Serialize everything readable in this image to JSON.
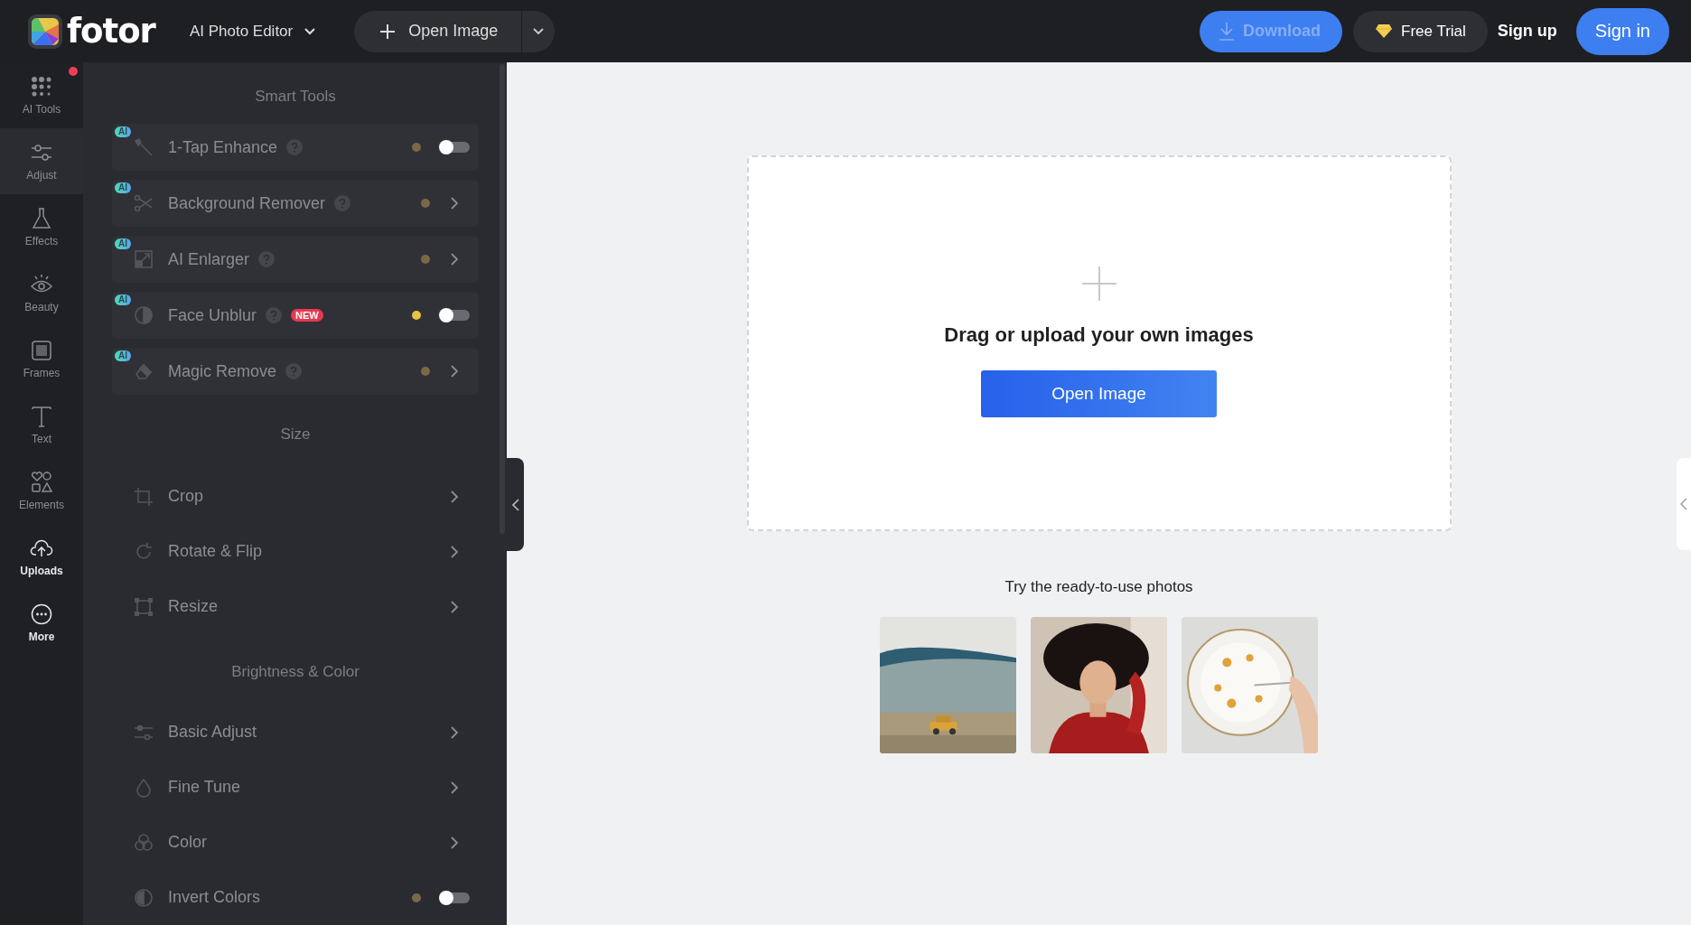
{
  "topbar": {
    "logo": "fotor",
    "editor_menu": "AI Photo Editor",
    "open_image": "Open Image",
    "download": {
      "label": "Download",
      "disabled": true
    },
    "free_trial": "Free Trial",
    "sign_up": "Sign up",
    "sign_in": "Sign in"
  },
  "rail": [
    {
      "label": "AI Tools",
      "selected": false,
      "highlighted": false,
      "notification": true
    },
    {
      "label": "Adjust",
      "selected": true,
      "highlighted": false,
      "notification": false
    },
    {
      "label": "Effects",
      "selected": false,
      "highlighted": false,
      "notification": false
    },
    {
      "label": "Beauty",
      "selected": false,
      "highlighted": false,
      "notification": false
    },
    {
      "label": "Frames",
      "selected": false,
      "highlighted": false,
      "notification": false
    },
    {
      "label": "Text",
      "selected": false,
      "highlighted": false,
      "notification": false
    },
    {
      "label": "Elements",
      "selected": false,
      "highlighted": false,
      "notification": false
    },
    {
      "label": "Uploads",
      "selected": false,
      "highlighted": true,
      "notification": false
    },
    {
      "label": "More",
      "selected": false,
      "highlighted": true,
      "notification": false
    }
  ],
  "panel": {
    "sections": [
      {
        "title": "Smart Tools",
        "kind": "cards",
        "items": [
          {
            "badge": "AI",
            "label": "1-Tap Enhance",
            "help": true,
            "kind": "toggle",
            "on": false,
            "color": "#7a6847"
          },
          {
            "badge": "AI",
            "label": "Background Remover",
            "help": true,
            "kind": "chevron",
            "color": "#7a6847"
          },
          {
            "badge": "AI",
            "label": "AI Enlarger",
            "help": true,
            "kind": "chevron",
            "color": "#7a6847"
          },
          {
            "badge": "AI",
            "label": "Face Unblur",
            "help": true,
            "tag": "NEW",
            "kind": "toggle",
            "on": false,
            "color": "#e8c345"
          },
          {
            "badge": "AI",
            "label": "Magic Remove",
            "help": true,
            "kind": "chevron",
            "color": "#7a6847"
          }
        ]
      },
      {
        "title": "Size",
        "kind": "rows",
        "items": [
          {
            "label": "Crop",
            "kind": "chevron"
          },
          {
            "label": "Rotate & Flip",
            "kind": "chevron"
          },
          {
            "label": "Resize",
            "kind": "chevron"
          }
        ]
      },
      {
        "title": "Brightness & Color",
        "kind": "rows",
        "items": [
          {
            "label": "Basic Adjust",
            "kind": "chevron"
          },
          {
            "label": "Fine Tune",
            "kind": "chevron"
          },
          {
            "label": "Color",
            "kind": "chevron"
          },
          {
            "label": "Invert Colors",
            "kind": "toggle",
            "on": false,
            "color": "#7a6847"
          }
        ]
      }
    ]
  },
  "canvas": {
    "drop_title": "Drag or upload your own images",
    "button": "Open Image",
    "samples_caption": "Try the ready-to-use photos"
  }
}
